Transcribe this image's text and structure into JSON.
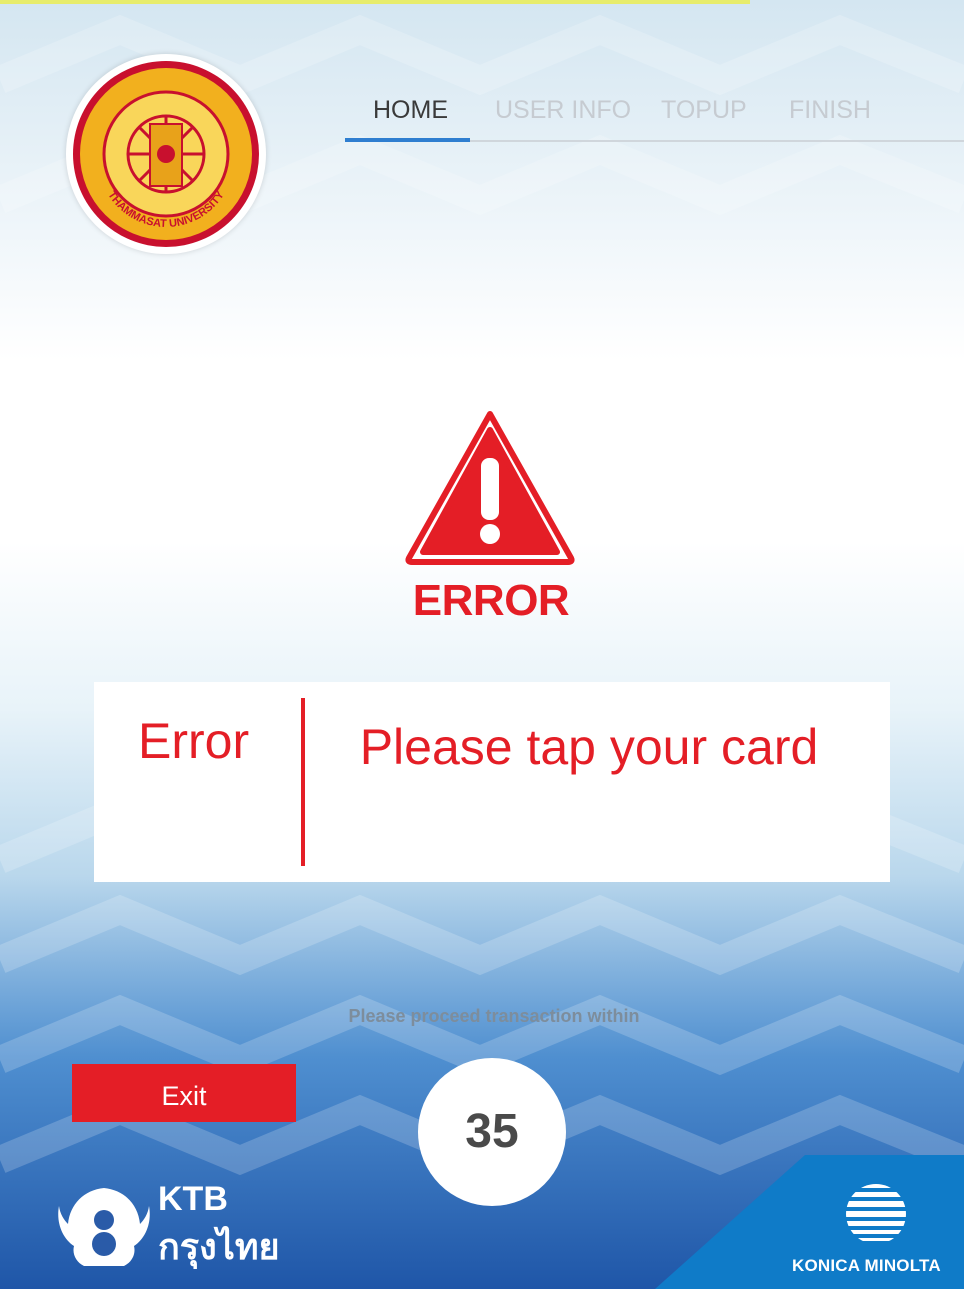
{
  "nav": {
    "items": [
      {
        "label": "HOME",
        "active": true
      },
      {
        "label": "USER INFO",
        "active": false
      },
      {
        "label": "TOPUP",
        "active": false
      },
      {
        "label": "FINISH",
        "active": false
      }
    ]
  },
  "logo": {
    "icon": "thammasat-university-seal",
    "text": "THAMMASAT UNIVERSITY"
  },
  "error": {
    "icon": "warning-icon",
    "title": "ERROR",
    "label": "Error",
    "message": "Please tap your card"
  },
  "countdown": {
    "label": "Please proceed transaction within",
    "value": "35"
  },
  "exit_button": {
    "label": "Exit"
  },
  "footer": {
    "ktb_name": "KTB",
    "ktb_thai": "กรุงไทย",
    "konica": "KONICA MINOLTA"
  },
  "colors": {
    "accent_red": "#e41e26",
    "nav_active": "#2f7ed0"
  }
}
